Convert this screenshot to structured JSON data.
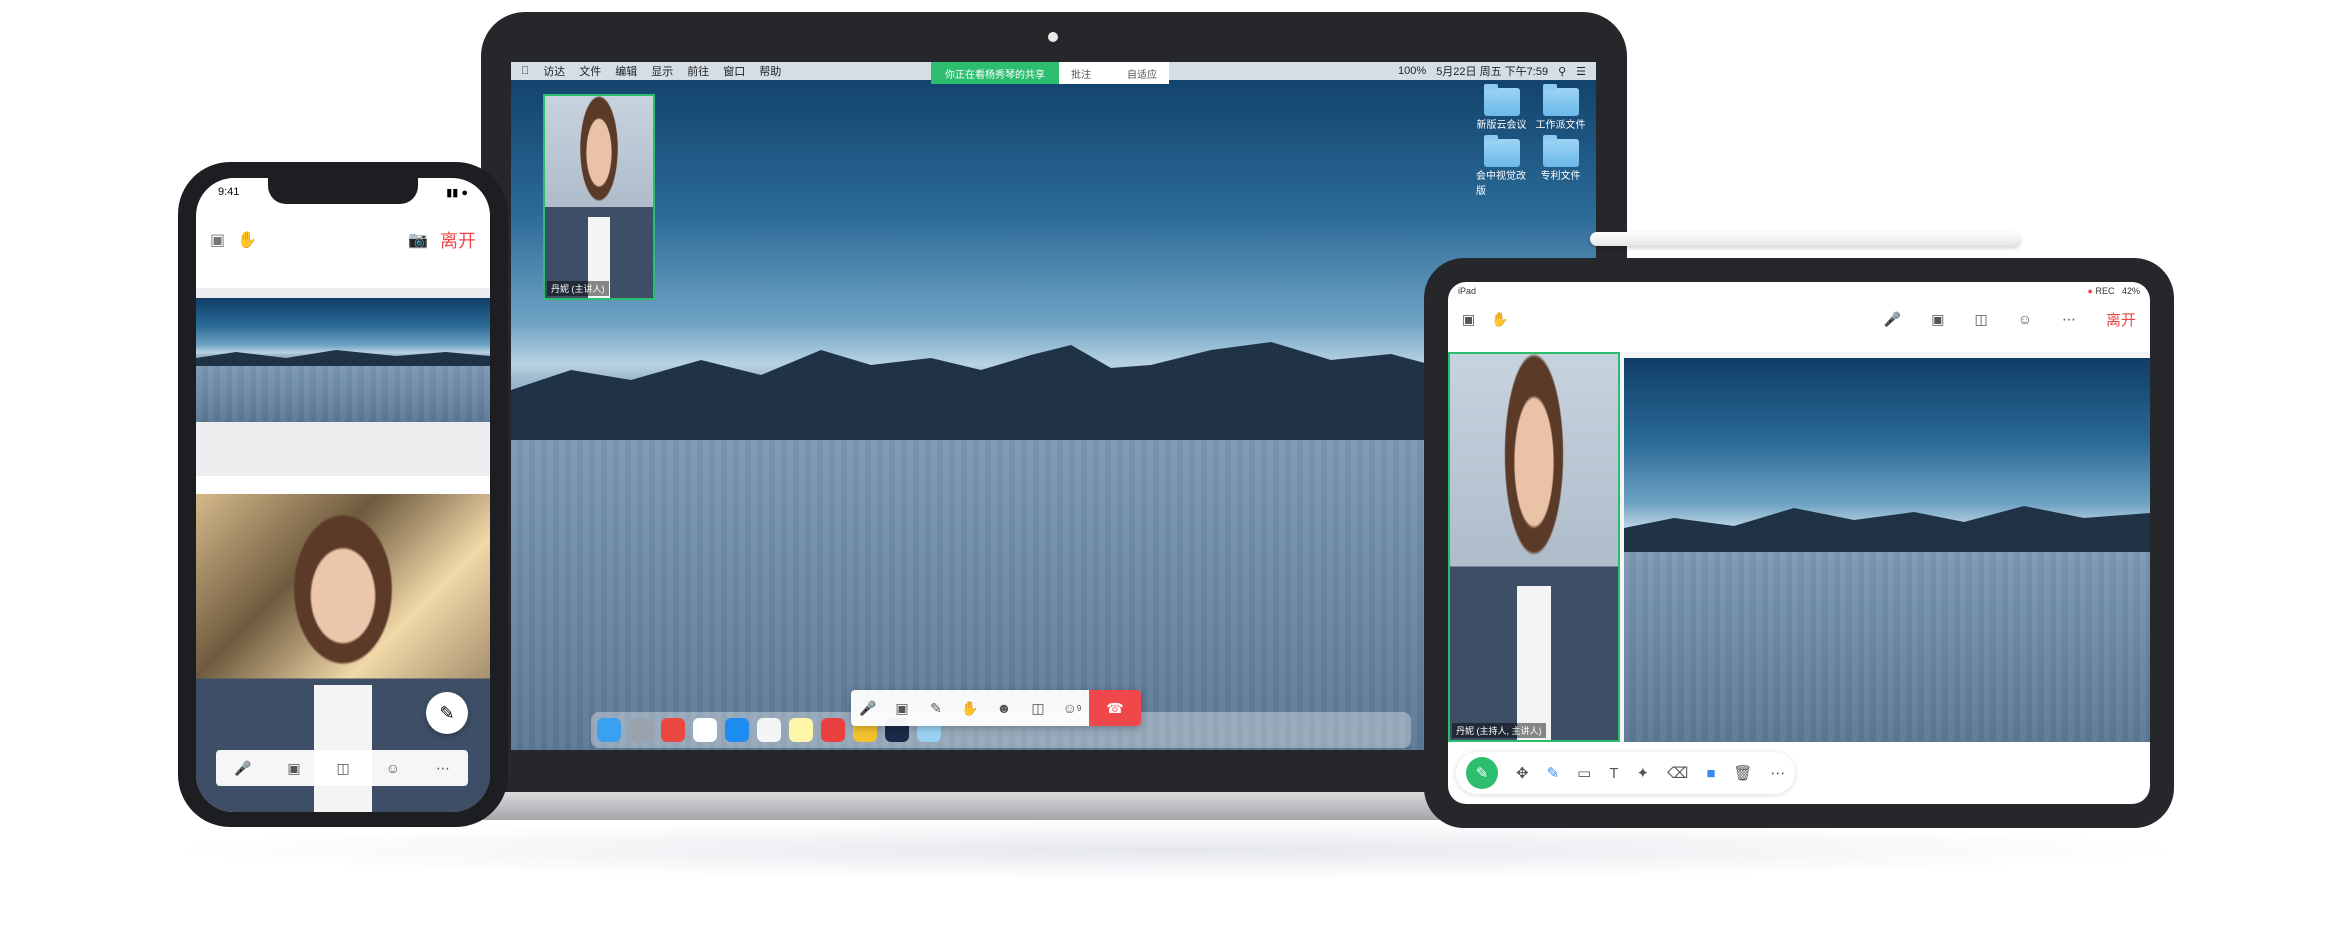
{
  "laptop": {
    "menubar": {
      "items": [
        "访达",
        "文件",
        "编辑",
        "显示",
        "前往",
        "窗口",
        "帮助"
      ],
      "clock": "5月22日 周五 下午7:59",
      "battery": "100%"
    },
    "share_banner": {
      "sharing_text": "你正在看杨秀琴的共享",
      "annotate": "批注",
      "fit": "自适应"
    },
    "desktop_icons": [
      "新版云会议",
      "工作派文件",
      "会中视觉改版",
      "专利文件"
    ],
    "presenter_name": "丹妮 (主讲人)",
    "participants_badge": "9"
  },
  "phone": {
    "time": "9:41",
    "leave": "离开"
  },
  "tablet": {
    "device": "iPad",
    "rec": "REC",
    "battery": "42%",
    "leave": "离开",
    "presenter_name": "丹妮 (主持人, 主讲人)"
  }
}
